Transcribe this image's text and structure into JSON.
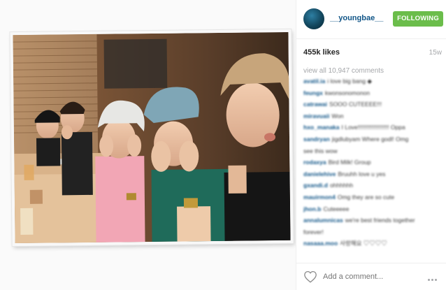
{
  "post": {
    "username": "__youngbae__",
    "follow_label": "FOLLOWING",
    "likes": "455k likes",
    "age": "15w",
    "view_all": "view all 10,947 comments",
    "add_comment_placeholder": "Add a comment...",
    "accent_color": "#6bbd4b",
    "link_color": "#125688",
    "comments": [
      {
        "user": "avatil.ia",
        "text": "i love big bang ◆"
      },
      {
        "user": "feungx",
        "text": "kwonsonomonon"
      },
      {
        "user": "catrawai",
        "text": "SOOO CUTEEEE!!!"
      },
      {
        "user": "miravuaii",
        "text": "Won"
      },
      {
        "user": "hxo_manaka",
        "text": "I Love!!!!!!!!!!!!!!!!!!! Oppa"
      },
      {
        "user": "sandryan",
        "text": "jigdlubyam Where godl! Omg"
      },
      {
        "user": "",
        "text": "see this wow"
      },
      {
        "user": "rodaxya",
        "text": "Bird Milk! Group"
      },
      {
        "user": "danielehive",
        "text": "Bruuhh love u yes"
      },
      {
        "user": "gxandi.d",
        "text": "ohhhhhh"
      },
      {
        "user": "mauirmon4",
        "text": "Omg they are so cute"
      },
      {
        "user": "jhon.b",
        "text": "Cuteeeee"
      },
      {
        "user": "annalumnicas",
        "text": "we're best friends together"
      },
      {
        "user": "",
        "text": "forever!"
      },
      {
        "user": "nasaaa.moo",
        "text": "사랑해요 ♡♡♡♡"
      }
    ]
  }
}
